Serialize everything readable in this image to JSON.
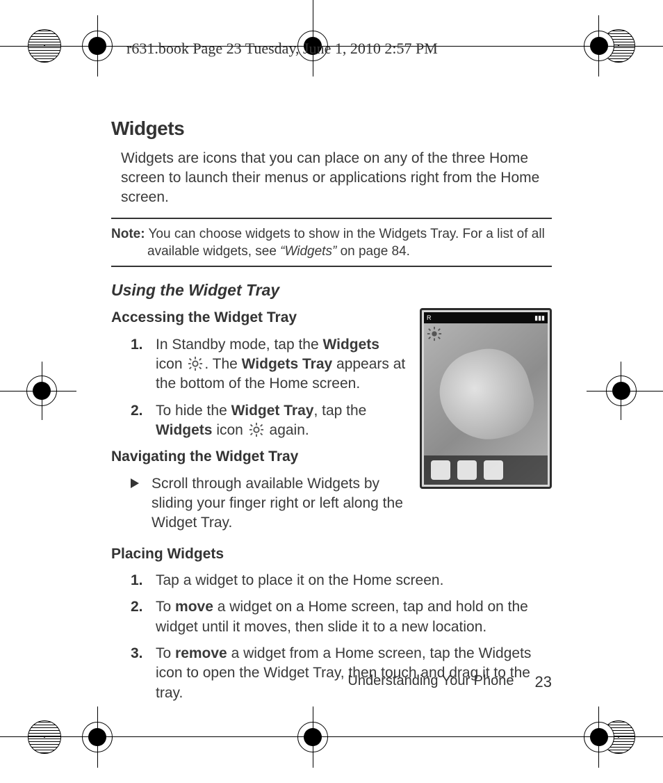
{
  "header": {
    "book_info": "r631.book  Page 23  Tuesday, June 1, 2010  2:57 PM"
  },
  "section_title": "Widgets",
  "intro": "Widgets are icons that you can place on any of the three Home screen to launch their menus or applications right from the Home screen.",
  "note": {
    "lead": "Note:",
    "body_1": "You can choose widgets to show in the Widgets Tray. For a list of all available widgets, see ",
    "ref": "“Widgets”",
    "body_2": " on page 84."
  },
  "subsection_title": "Using the Widget Tray",
  "accessing": {
    "title": "Accessing the Widget Tray",
    "steps": [
      {
        "num": "1.",
        "t1": "In Standby mode, tap the ",
        "b1": "Widgets",
        "t2": " icon ",
        "icon": "gear-icon",
        "t3": ". The ",
        "b2": "Widgets Tray",
        "t4": " appears at the bottom of the Home screen."
      },
      {
        "num": "2.",
        "t1": "To hide the ",
        "b1": "Widget Tray",
        "t2": ", tap the ",
        "b2": "Widgets",
        "t3": " icon ",
        "icon": "gear-icon",
        "t4": " again."
      }
    ]
  },
  "navigating": {
    "title": "Navigating the Widget Tray",
    "bullet": "Scroll through available Widgets by sliding your finger right or left along the Widget Tray."
  },
  "placing": {
    "title": "Placing Widgets",
    "steps": [
      {
        "num": "1.",
        "text": "Tap a widget to place it on the Home screen."
      },
      {
        "num": "2.",
        "t1": "To ",
        "b1": "move",
        "t2": " a widget on a Home screen, tap and hold on the widget until it moves, then slide it to a new location."
      },
      {
        "num": "3.",
        "t1": "To ",
        "b1": "remove",
        "t2": " a widget from a Home screen, tap the Widgets icon to open the Widget Tray, then touch and drag it to the tray."
      }
    ]
  },
  "footer": {
    "chapter": "Understanding Your Phone",
    "page": "23"
  },
  "phone_preview": {
    "status_left": "R",
    "status_right": "▮▮▮",
    "tray_icons": [
      "globe-icon",
      "mail-icon",
      "contacts-icon"
    ]
  }
}
